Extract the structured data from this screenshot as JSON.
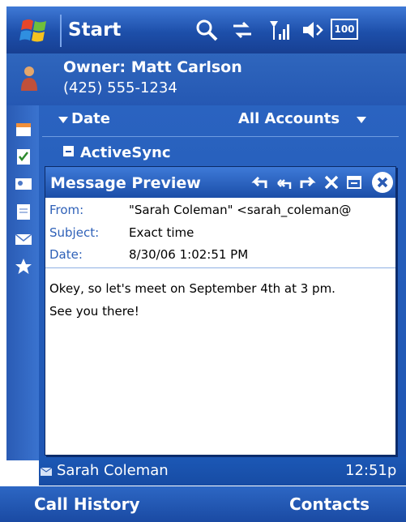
{
  "taskbar": {
    "start_label": "Start",
    "battery_label": "100"
  },
  "owner": {
    "name": "Owner: Matt Carlson",
    "phone": "(425) 555-1234"
  },
  "list": {
    "sort_label": "Date",
    "accounts_label": "All Accounts",
    "group_label": "ActiveSync",
    "selected_item": {
      "sender": "Sarah Coleman",
      "time": "12:51p"
    }
  },
  "preview": {
    "title": "Message Preview",
    "from_label": "From:",
    "from_value": "\"Sarah Coleman\" <sarah_coleman@",
    "subject_label": "Subject:",
    "subject_value": "Exact time",
    "date_label": "Date:",
    "date_value": "8/30/06 1:02:51 PM",
    "body_lines": [
      "Okey, so let's meet on September 4th at 3 pm.",
      "See you there!"
    ]
  },
  "softkeys": {
    "left": "Call History",
    "right": "Contacts"
  },
  "colors": {
    "accent": "#2558b3",
    "label_blue": "#2f61b8"
  }
}
